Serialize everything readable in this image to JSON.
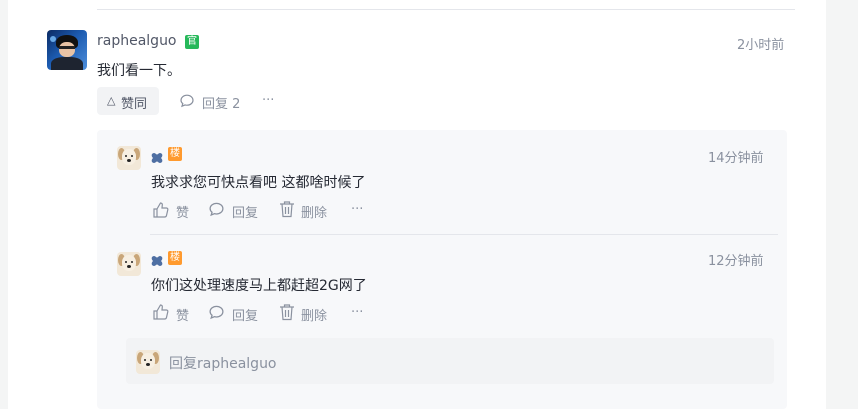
{
  "comment": {
    "username": "raphealguo",
    "official_badge": "官",
    "time": "2小时前",
    "content": "我们看一下。",
    "like_label": "赞同",
    "reply_label": "回复 2",
    "more_label": "···"
  },
  "replies": [
    {
      "author_badge": "楼",
      "time": "14分钟前",
      "content": "我求求您可快点看吧 这都啥时候了",
      "like_label": "赞",
      "reply_label": "回复",
      "delete_label": "删除",
      "more_label": "···"
    },
    {
      "author_badge": "楼",
      "time": "12分钟前",
      "content": "你们这处理速度马上都赶超2G网了",
      "like_label": "赞",
      "reply_label": "回复",
      "delete_label": "删除",
      "more_label": "···"
    }
  ],
  "reply_box": {
    "placeholder": "回复raphealguo"
  },
  "colors": {
    "official_badge": "#26b85a",
    "author_badge": "#ff9a2e",
    "text_primary": "#252933",
    "text_secondary": "#8a919f"
  },
  "icons": {
    "like": "thumb-up-icon",
    "reply": "comment-bubble-icon",
    "delete": "trash-icon",
    "more": "more-dots-icon",
    "upvote": "triangle-up-icon",
    "nickname": "blob-nickname-icon"
  }
}
